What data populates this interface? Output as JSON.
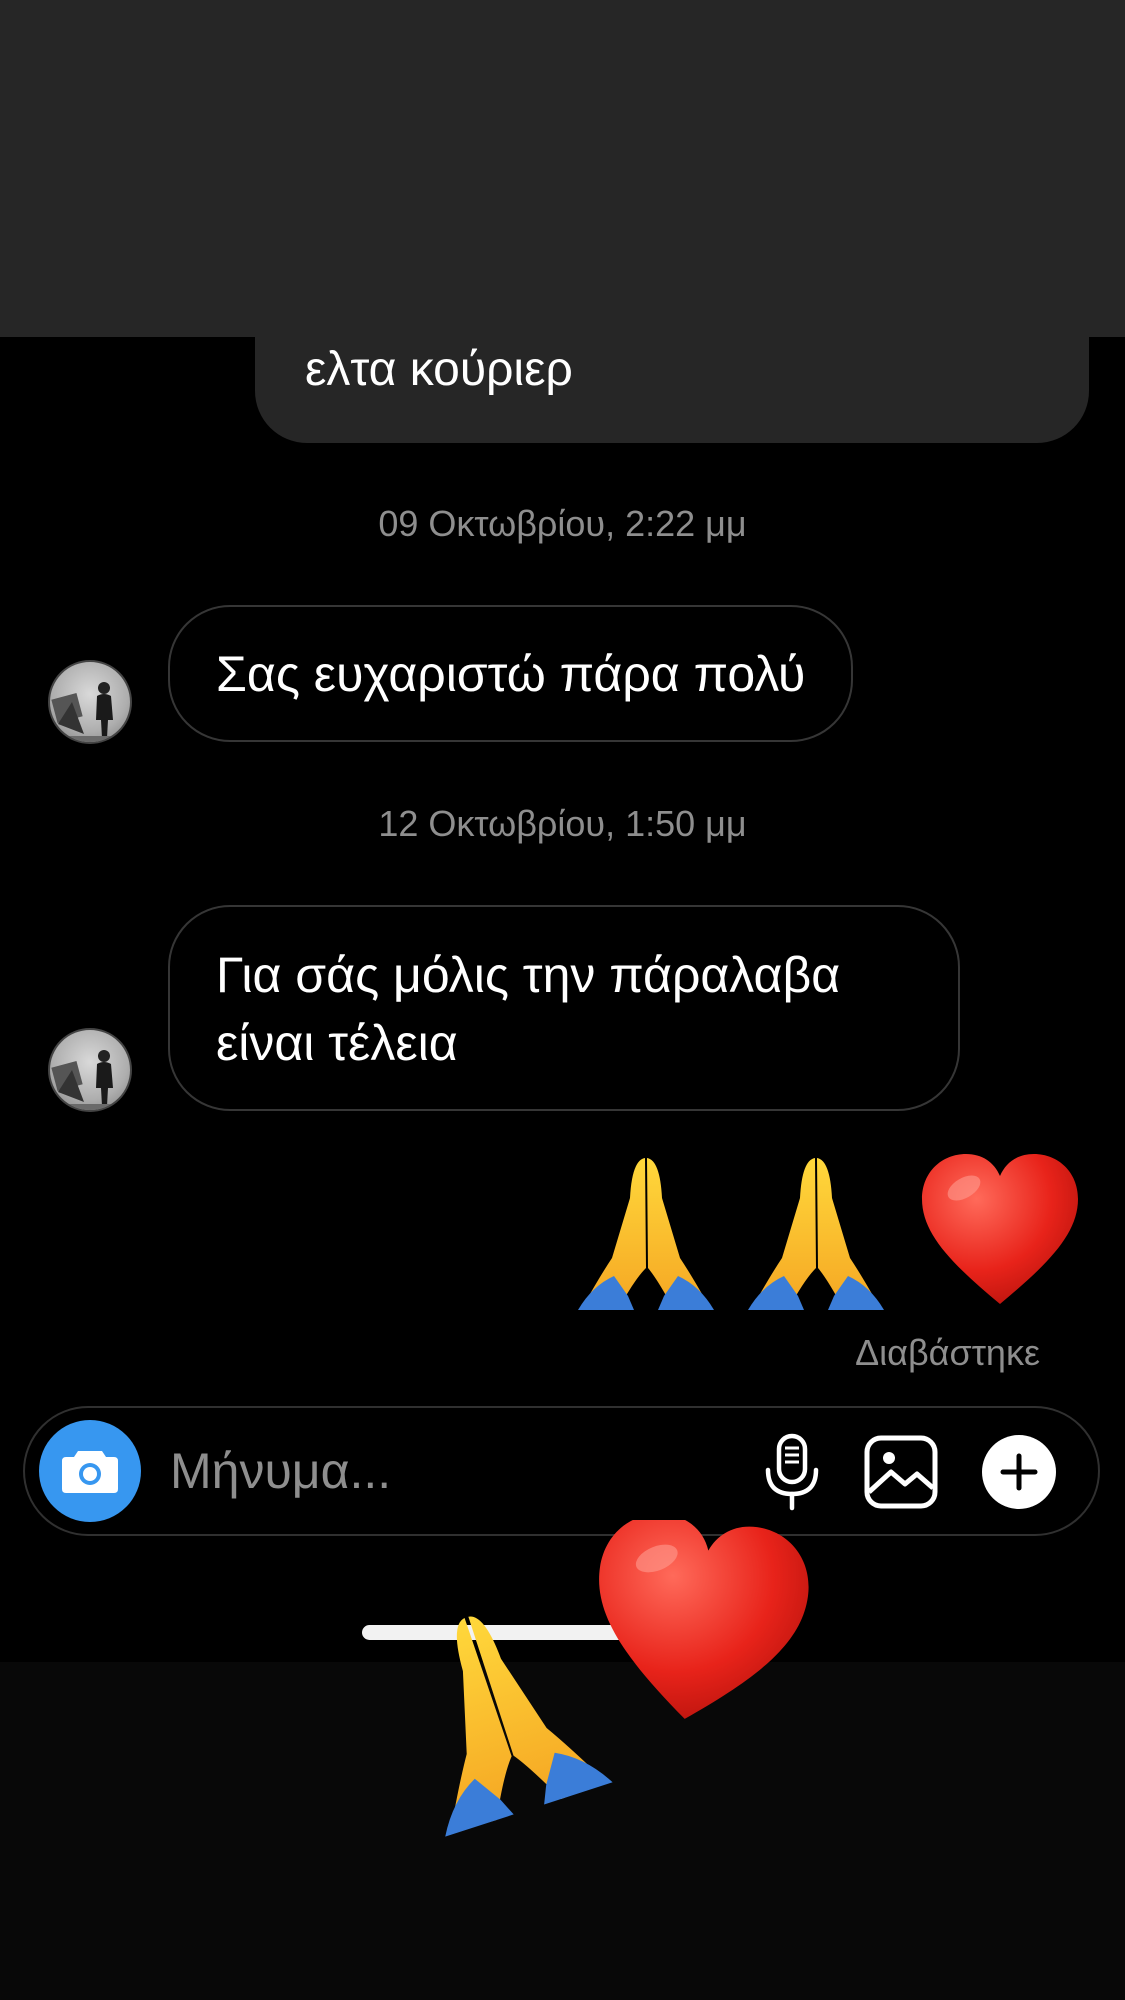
{
  "thread": {
    "outgoing_message": "ελτα κούριερ",
    "timestamp_1": "09 Οκτωβρίου, 2:22 μμ",
    "incoming_message_1": "Σας ευχαριστώ πάρα πολύ",
    "timestamp_2": "12 Οκτωβρίου, 1:50 μμ",
    "incoming_message_2_line1": "Για σάς μόλις την πάραλαβα",
    "incoming_message_2_line2": "είναι τέλεια",
    "outgoing_emoji_message": [
      "folded-hands",
      "folded-hands",
      "red-heart"
    ],
    "read_status": "Διαβάστηκε"
  },
  "composer": {
    "placeholder": "Μήνυμα...",
    "icons": [
      "camera-icon",
      "microphone-icon",
      "gallery-icon",
      "plus-icon"
    ]
  },
  "colors": {
    "background": "#000000",
    "top_band": "#262626",
    "outgoing_bubble": "#262626",
    "secondary_text": "#8e8e8e",
    "accent_blue": "#3797f0"
  }
}
